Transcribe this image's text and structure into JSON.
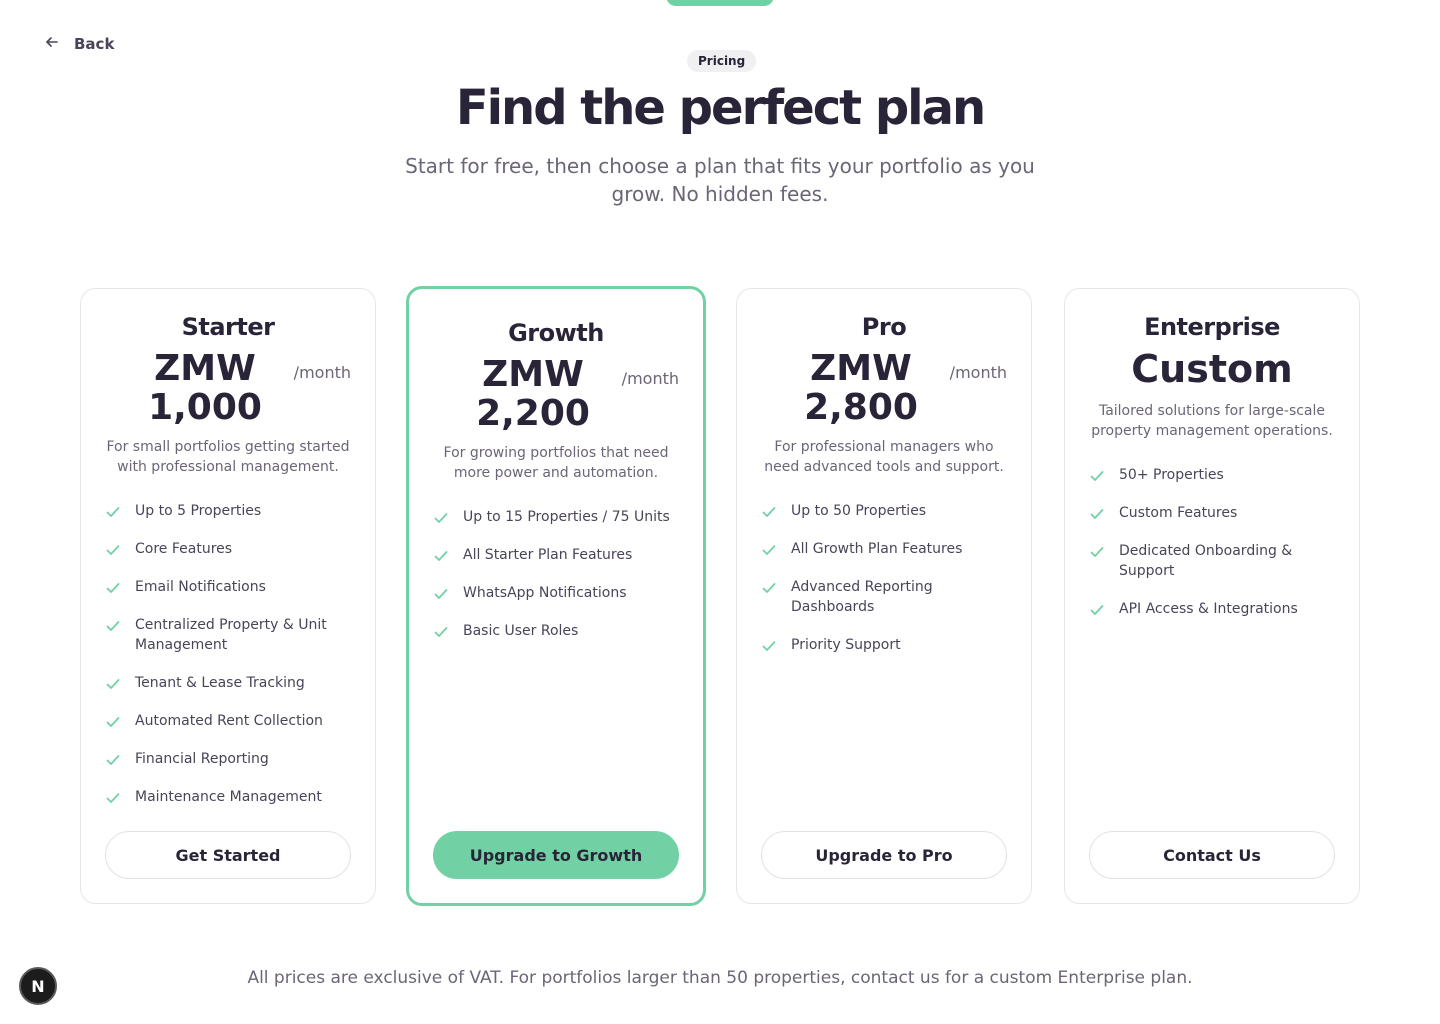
{
  "nav": {
    "back_label": "Back"
  },
  "header": {
    "badge": "Pricing",
    "title": "Find the perfect plan",
    "subtitle": "Start for free, then choose a plan that fits your portfolio as you grow. No hidden fees."
  },
  "plans": [
    {
      "name": "Starter",
      "price": "ZMW 1,000",
      "period": "/month",
      "description": "For small portfolios getting started with professional management.",
      "features": [
        "Up to 5 Properties",
        "Core Features",
        "Email Notifications",
        "Centralized Property & Unit Management",
        "Tenant & Lease Tracking",
        "Automated Rent Collection",
        "Financial Reporting",
        "Maintenance Management"
      ],
      "cta": "Get Started"
    },
    {
      "name": "Growth",
      "price": "ZMW 2,200",
      "period": "/month",
      "description": "For growing portfolios that need more power and automation.",
      "features": [
        "Up to 15 Properties / 75 Units",
        "All Starter Plan Features",
        "WhatsApp Notifications",
        "Basic User Roles"
      ],
      "cta": "Upgrade to Growth"
    },
    {
      "name": "Pro",
      "price": "ZMW 2,800",
      "period": "/month",
      "description": "For professional managers who need advanced tools and support.",
      "features": [
        "Up to 50 Properties",
        "All Growth Plan Features",
        "Advanced Reporting Dashboards",
        "Priority Support"
      ],
      "cta": "Upgrade to Pro"
    },
    {
      "name": "Enterprise",
      "price": "Custom",
      "description": "Tailored solutions for large-scale property management operations.",
      "features": [
        "50+ Properties",
        "Custom Features",
        "Dedicated Onboarding & Support",
        "API Access & Integrations"
      ],
      "cta": "Contact Us"
    }
  ],
  "footnote": "All prices are exclusive of VAT. For portfolios larger than 50 properties, contact us for a custom Enterprise plan.",
  "dev_badge": "N",
  "colors": {
    "accent": "#72d1a4",
    "text": "#2a2438",
    "muted": "#6b6577"
  },
  "icons": {
    "back": "arrow-left-icon",
    "check": "check-icon"
  }
}
